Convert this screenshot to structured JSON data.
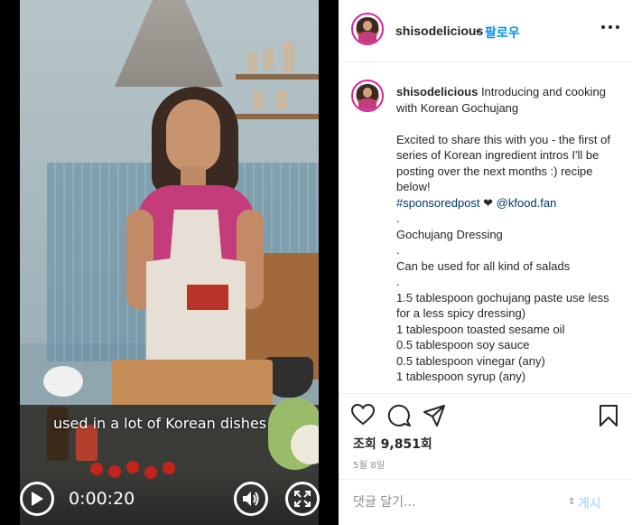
{
  "video": {
    "caption": "used in a lot of Korean dishes",
    "time": "0:00:20"
  },
  "header": {
    "username": "shisodelicious",
    "separator": "•",
    "follow_label": "팔로우",
    "more_icon": "more-icon"
  },
  "post": {
    "username": "shisodelicious",
    "lines": [
      "Introducing and cooking with Korean Gochujang",
      "",
      "Excited to share this with you - the first of series of Korean ingredient intros I'll be posting over the next months :) recipe below!",
      ".",
      "Gochujang Dressing",
      ".",
      "Can be used for all kind of salads",
      ".",
      "1.5 tablespoon gochujang paste use less for a less spicy dressing)",
      "1 tablespoon toasted sesame oil",
      "0.5 tablespoon soy sauce",
      "0.5 tablespoon vinegar (any)",
      "1 tablespoon syrup (any)"
    ],
    "hashtag": "#sponsoredpost",
    "heart": "❤",
    "mention": "@kfood.fan"
  },
  "stats": {
    "views": "조회 9,851회",
    "date": "5월 8일"
  },
  "comment": {
    "placeholder": "댓글 달기...",
    "post_label": "게시"
  }
}
